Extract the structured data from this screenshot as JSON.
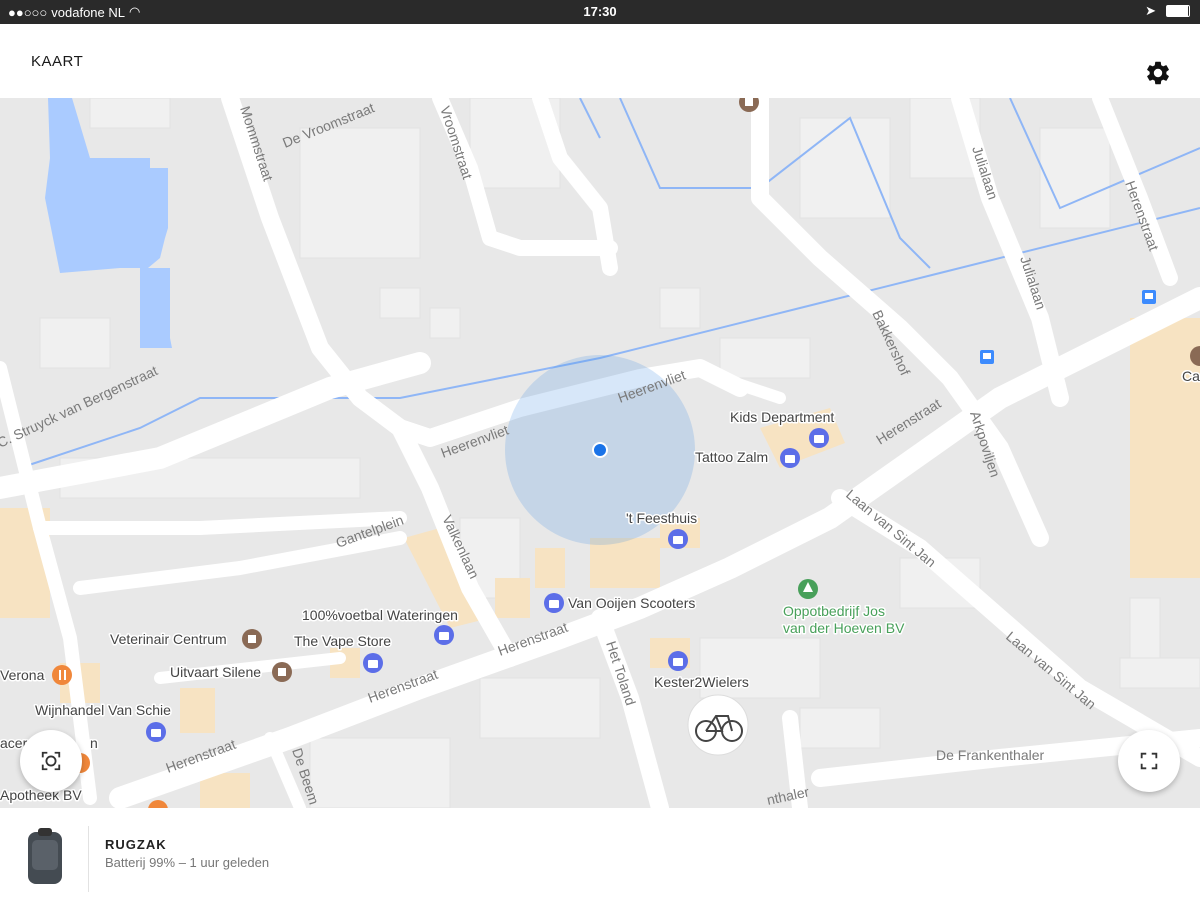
{
  "status_bar": {
    "carrier": "vodafone NL",
    "time": "17:30"
  },
  "app_bar": {
    "title": "KAART",
    "settings_icon": "gear-icon"
  },
  "map": {
    "streets": [
      "De Vroomstraat",
      "Mommstraat",
      "Vroomstraat",
      "Julialaan",
      "Julialaan",
      "Herenstraat",
      "C. Struyck van Bergenstraat",
      "Heerenvliet",
      "Heerenvliet",
      "Bakkershof",
      "Herenstraat",
      "Arkpoviljen",
      "Gantelplein",
      "Valkenlaan",
      "Laan van Sint Jan",
      "Laan van Sint Jan",
      "Herenstraat",
      "Herenstraat",
      "Herenstraat",
      "Het Toland",
      "De Beem",
      "De Frankenthaler",
      "nthaler"
    ],
    "places": [
      "Kids Department",
      "Tattoo Zalm",
      "'t Feesthuis",
      "Van Ooijen Scooters",
      "100%voetbal Wateringen",
      "The Vape Store",
      "Veterinair Centrum",
      "Uitvaart Silene",
      "Verona",
      "Wijnhandel Van Schie",
      "Oppotbedrijf Jos",
      "van der Hoeven BV",
      "Kester2Wielers",
      "Apotheek BV",
      "acer",
      "n",
      "Ca"
    ]
  },
  "fab_left_icon": "center-focus-icon",
  "fab_right_icon": "fullscreen-icon",
  "item": {
    "name": "RUGZAK",
    "status": "Batterij 99% – 1 uur geleden",
    "icon": "backpack-icon"
  },
  "colors": {
    "road": "#ffffff",
    "block": "#e8e8e8",
    "water": "#aacbff",
    "commercial": "#f7e3c2",
    "accent": "#1a73e8",
    "green": "#48a05a"
  }
}
